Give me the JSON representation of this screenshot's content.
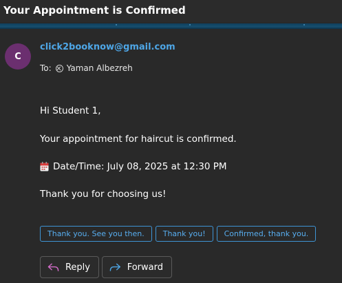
{
  "header": {
    "title": "Your Appointment is Confirmed"
  },
  "theme": {
    "background": "#292929",
    "accent": "#4ea6e6",
    "avatar_color": "#6b2f6f",
    "chip_border": "#3f95d6"
  },
  "message": {
    "avatar_initial": "C",
    "sender": "click2booknow@gmail.com",
    "to_label": "To:",
    "recipient": "Yaman Albezreh",
    "recipient_icon": "remove-icon",
    "greeting": "Hi Student 1,",
    "body": "Your appointment for haircut is confirmed.",
    "datetime_icon": "calendar-icon",
    "datetime": "Date/Time: July 08, 2025 at 12:30 PM",
    "closing": "Thank you for choosing us!"
  },
  "quick_replies": [
    "Thank you. See you then.",
    "Thank you!",
    "Confirmed, thank you."
  ],
  "actions": {
    "reply": {
      "label": "Reply",
      "icon": "reply-arrow-icon"
    },
    "forward": {
      "label": "Forward",
      "icon": "forward-arrow-icon"
    }
  }
}
